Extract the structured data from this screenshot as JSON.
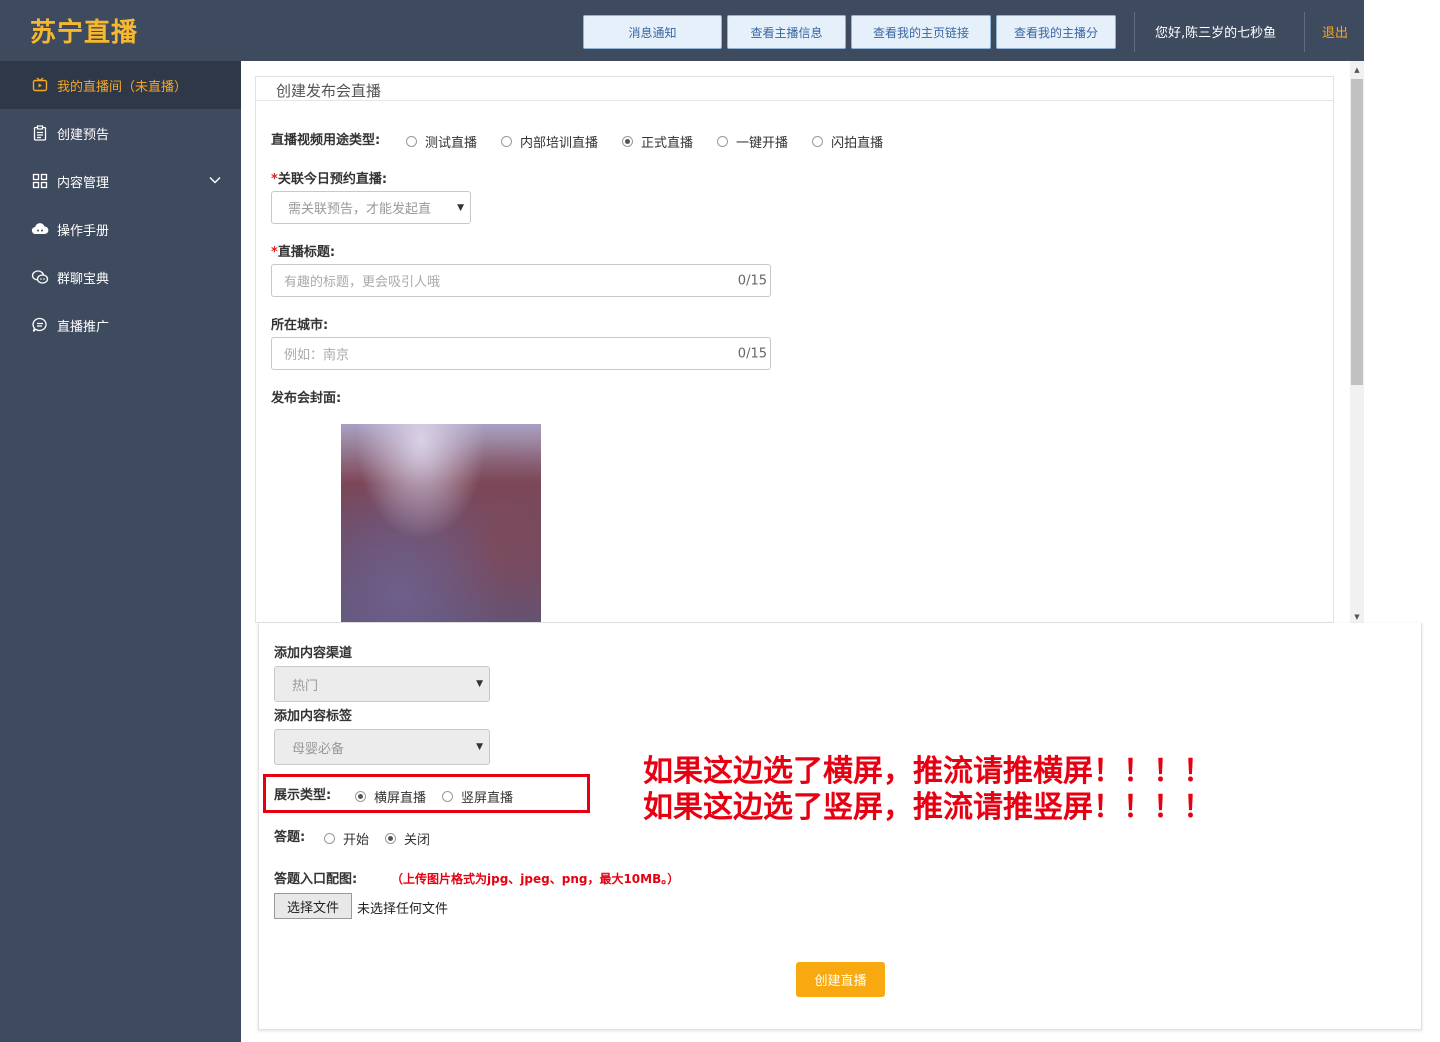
{
  "header": {
    "logo": "苏宁直播",
    "buttons": [
      "消息通知",
      "查看主播信息",
      "查看我的主页链接",
      "查看我的主播分"
    ],
    "greeting": "您好,陈三岁的七秒鱼",
    "logout": "退出"
  },
  "sidebar": {
    "items": [
      {
        "label": "我的直播间（未直播）",
        "icon": "tv-icon"
      },
      {
        "label": "创建预告",
        "icon": "clipboard-icon"
      },
      {
        "label": "内容管理",
        "icon": "grid-icon"
      },
      {
        "label": "操作手册",
        "icon": "cloud-icon"
      },
      {
        "label": "群聊宝典",
        "icon": "chat-bubbles-icon"
      },
      {
        "label": "直播推广",
        "icon": "message-icon"
      }
    ]
  },
  "form": {
    "panel_title": "创建发布会直播",
    "purpose_label": "直播视频用途类型:",
    "purpose_options": [
      "测试直播",
      "内部培训直播",
      "正式直播",
      "一键开播",
      "闪拍直播"
    ],
    "purpose_selected": "正式直播",
    "link_label": "关联今日预约直播:",
    "link_placeholder": "需关联预告，才能发起直",
    "title_label": "直播标题:",
    "title_placeholder": "有趣的标题，更会吸引人哦",
    "title_count": "0/15",
    "city_label": "所在城市:",
    "city_placeholder": "例如：南京",
    "city_count": "0/15",
    "cover_label": "发布会封面:",
    "channel_label": "添加内容渠道",
    "channel_value": "热门",
    "tag_label": "添加内容标签",
    "tag_value": "母婴必备",
    "display_label": "展示类型:",
    "display_options": [
      "横屏直播",
      "竖屏直播"
    ],
    "display_selected": "横屏直播",
    "quiz_label": "答题:",
    "quiz_options": [
      "开始",
      "关闭"
    ],
    "quiz_selected": "关闭",
    "quiz_image_label": "答题入口配图:",
    "quiz_image_note": "（上传图片格式为jpg、jpeg、png，最大10MB。）",
    "file_button": "选择文件",
    "file_status": "未选择任何文件",
    "submit": "创建直播"
  },
  "annotation": {
    "line1": "如果这边选了横屏，推流请推横屏！！！！",
    "line2": "如果这边选了竖屏，推流请推竖屏！！！！"
  },
  "colors": {
    "header_bg": "#3e4a5d",
    "accent": "#f5a623",
    "alert_red": "#e60012",
    "button_primary": "#f7a90f"
  }
}
